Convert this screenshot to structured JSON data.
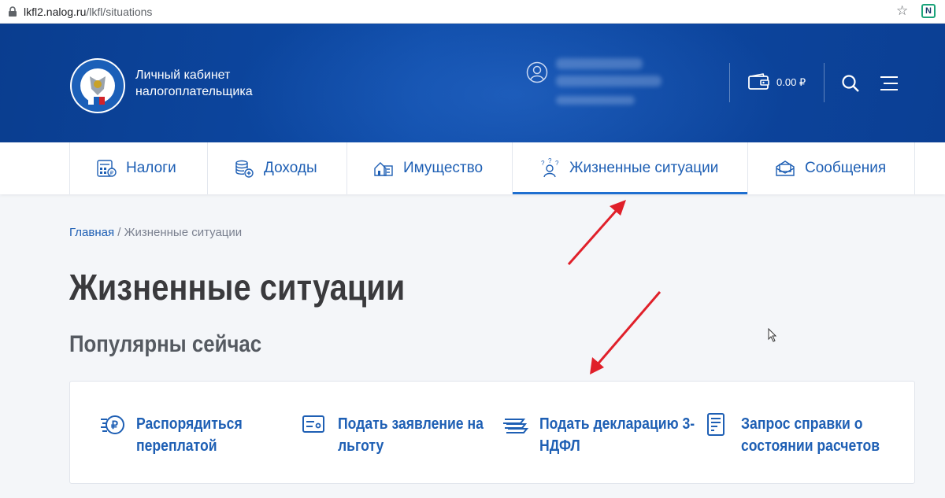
{
  "browser": {
    "url_host": "lkfl2.nalog.ru",
    "url_path": "/lkfl/situations"
  },
  "header": {
    "brand_line1": "Личный кабинет",
    "brand_line2": "налогоплательщика",
    "balance": "0.00 ₽"
  },
  "nav": {
    "tabs": [
      {
        "label": "Налоги",
        "icon": "taxes-icon",
        "active": false
      },
      {
        "label": "Доходы",
        "icon": "income-coins-icon",
        "active": false
      },
      {
        "label": "Имущество",
        "icon": "property-icon",
        "active": false
      },
      {
        "label": "Жизненные ситуации",
        "icon": "life-situations-icon",
        "active": true
      },
      {
        "label": "Сообщения",
        "icon": "messages-icon",
        "active": false
      }
    ]
  },
  "breadcrumb": {
    "home": "Главная",
    "separator": " / ",
    "current": "Жизненные ситуации"
  },
  "page": {
    "title": "Жизненные ситуации",
    "subtitle": "Популярны сейчас"
  },
  "popular": [
    {
      "line1": "Распорядиться",
      "line2": "переплатой",
      "icon": "ruble-overpayment-icon"
    },
    {
      "line1": "Подать заявление на",
      "line2": "льготу",
      "icon": "benefit-application-icon"
    },
    {
      "line1": "Подать декларацию 3-",
      "line2": "НДФЛ",
      "icon": "declaration-icon"
    },
    {
      "line1": "Запрос справки о",
      "line2": "состоянии расчетов",
      "icon": "certificate-request-icon"
    }
  ],
  "colors": {
    "header_blue": "#0d4aa6",
    "link_blue": "#1e5fb4",
    "active_underline": "#1e6fd0",
    "annotation_red": "#e0202a"
  }
}
